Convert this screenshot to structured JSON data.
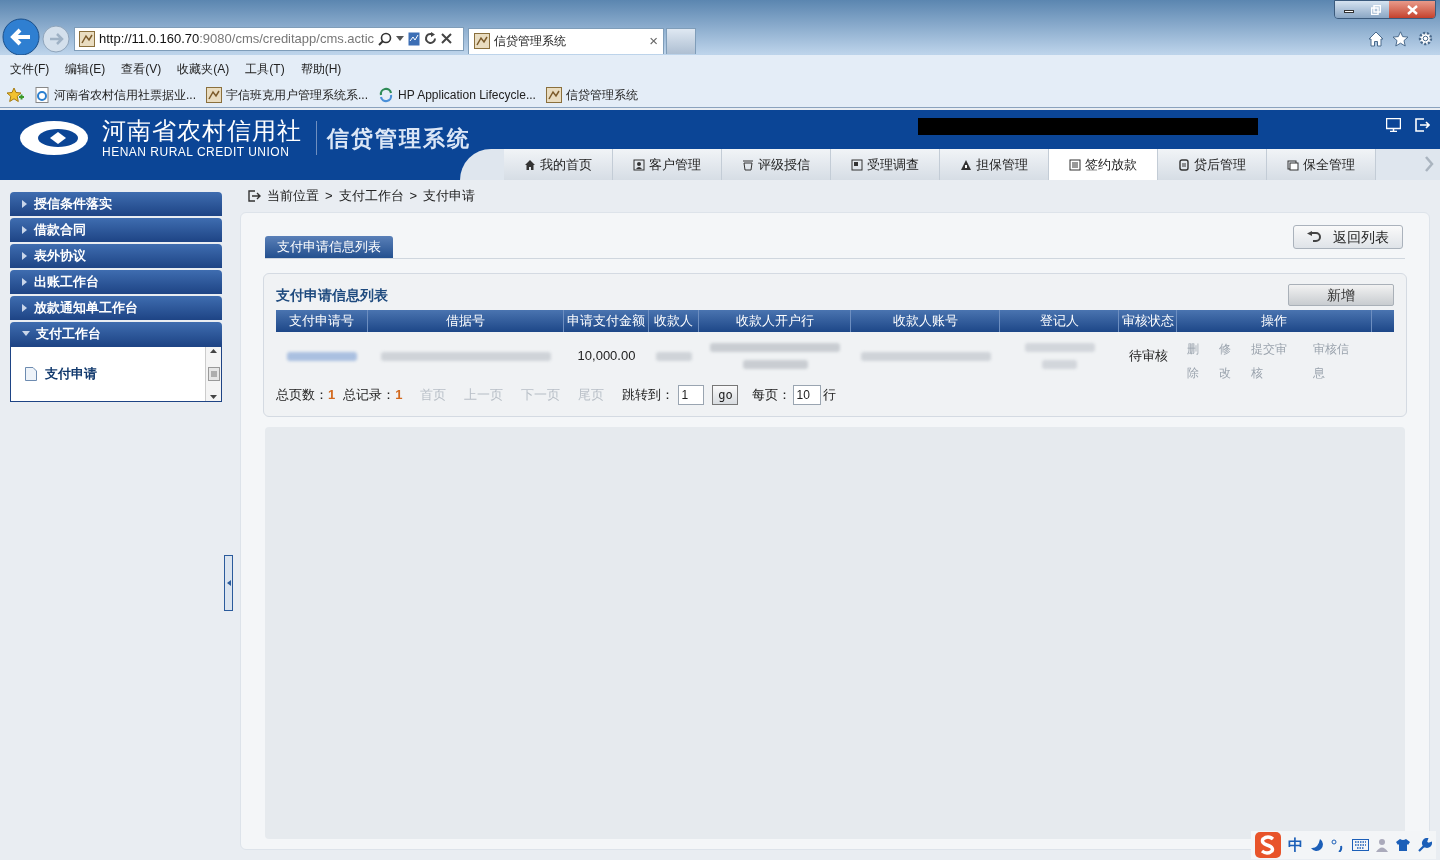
{
  "browser": {
    "address_host": "http://11.0.160.70",
    "address_rest": ":9080/cms/creditapp/cms.actic",
    "tab_title": "信贷管理系统",
    "tab_close": "×",
    "menu": [
      "文件(F)",
      "编辑(E)",
      "查看(V)",
      "收藏夹(A)",
      "工具(T)",
      "帮助(H)"
    ],
    "favorites": [
      {
        "label": "河南省农村信用社票据业...",
        "kind": "ie"
      },
      {
        "label": "宇信班克用户管理系统系...",
        "kind": "page"
      },
      {
        "label": "HP Application Lifecycle...",
        "kind": "hp"
      },
      {
        "label": "信贷管理系统",
        "kind": "page"
      }
    ]
  },
  "header": {
    "org_name": "河南省农村信用社",
    "org_name_en": "HENAN RURAL CREDIT UNION",
    "system_name": "信贷管理系统"
  },
  "nav_tabs": [
    {
      "label": "我的首页",
      "selected": false
    },
    {
      "label": "客户管理",
      "selected": false
    },
    {
      "label": "评级授信",
      "selected": false
    },
    {
      "label": "受理调查",
      "selected": false
    },
    {
      "label": "担保管理",
      "selected": false
    },
    {
      "label": "签约放款",
      "selected": true
    },
    {
      "label": "贷后管理",
      "selected": false
    },
    {
      "label": "保全管理",
      "selected": false
    }
  ],
  "sidebar": {
    "items": [
      {
        "label": "授信条件落实",
        "expanded": false
      },
      {
        "label": "借款合同",
        "expanded": false
      },
      {
        "label": "表外协议",
        "expanded": false
      },
      {
        "label": "出账工作台",
        "expanded": false
      },
      {
        "label": "放款通知单工作台",
        "expanded": false
      },
      {
        "label": "支付工作台",
        "expanded": true,
        "children": [
          {
            "label": "支付申请",
            "selected": true
          }
        ]
      }
    ]
  },
  "breadcrumb": [
    "当前位置",
    "支付工作台",
    "支付申请"
  ],
  "breadcrumb_separator": ">",
  "page_tab": "支付申请信息列表",
  "return_button": "返回列表",
  "panel": {
    "title": "支付申请信息列表",
    "add_button": "新增",
    "table": {
      "columns": [
        "支付申请号",
        "借据号",
        "申请支付金额",
        "收款人",
        "收款人开户行",
        "收款人账号",
        "登记人",
        "审核状态",
        "操作"
      ],
      "rows": [
        {
          "amount": "10,000.00",
          "status": "待审核",
          "actions": [
            {
              "label": "删除",
              "disabled": true
            },
            {
              "label": "修改",
              "disabled": true
            },
            {
              "label": "提交审核",
              "disabled": true
            },
            {
              "label": "审核信息",
              "disabled": true
            }
          ]
        }
      ]
    },
    "pager": {
      "total_pages_label": "总页数：",
      "total_pages": "1",
      "total_records_label": "总记录：",
      "total_records": "1",
      "links": [
        {
          "label": "首页",
          "disabled": true
        },
        {
          "label": "上一页",
          "disabled": true
        },
        {
          "label": "下一页",
          "disabled": true
        },
        {
          "label": "尾页",
          "disabled": true
        }
      ],
      "jump_label": "跳转到：",
      "jump_value": "1",
      "go_button": "go",
      "per_page_label": "每页：",
      "per_page_value": "10",
      "per_page_unit": "行"
    }
  },
  "ime_bar": {
    "mode": "中"
  }
}
